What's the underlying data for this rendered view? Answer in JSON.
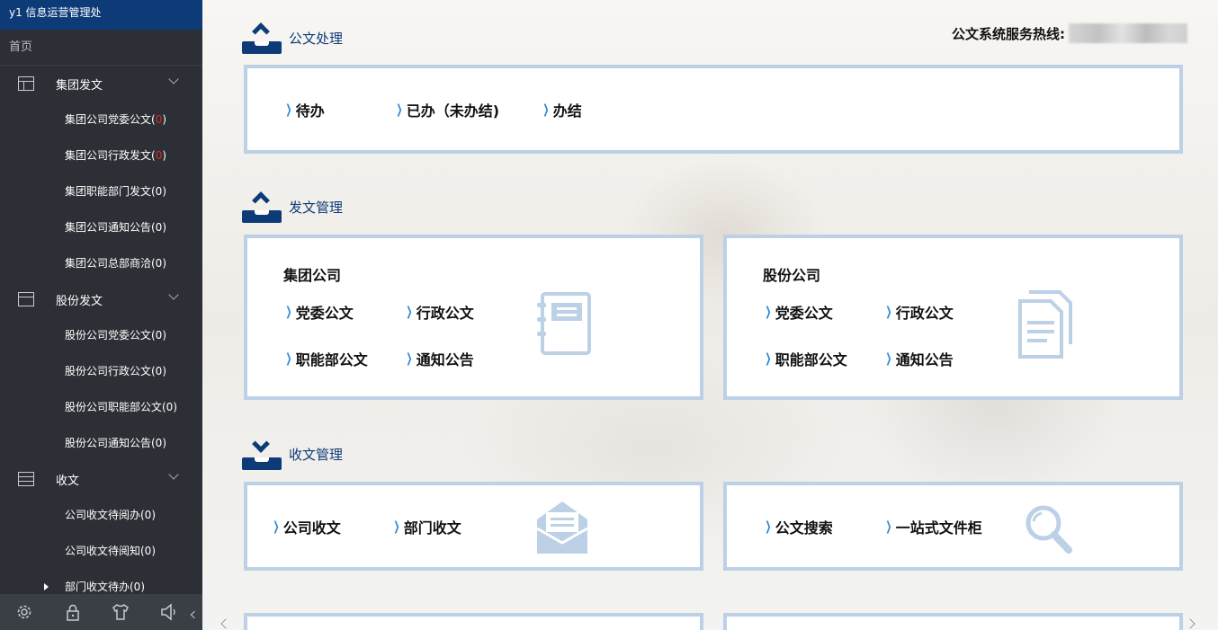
{
  "sidebar": {
    "org": "y1 信息运营管理处",
    "home": "首页",
    "groups": [
      {
        "label": "集团发文",
        "items": [
          {
            "text": "集团公司党委公文(",
            "count": "0",
            "tail": ")",
            "highlight": true
          },
          {
            "text": "集团公司行政发文(",
            "count": "0",
            "tail": ")",
            "highlight": true
          },
          {
            "text": "集团职能部门发文(0)"
          },
          {
            "text": "集团公司通知公告(0)"
          },
          {
            "text": "集团公司总部商洽(0)"
          }
        ]
      },
      {
        "label": "股份发文",
        "items": [
          {
            "text": "股份公司党委公文(0)"
          },
          {
            "text": "股份公司行政公文(0)"
          },
          {
            "text": "股份公司职能部公文(0)"
          },
          {
            "text": "股份公司通知公告(0)"
          }
        ]
      },
      {
        "label": "收文",
        "items": [
          {
            "text": "公司收文待阅办(0)"
          },
          {
            "text": "公司收文待阅知(0)"
          },
          {
            "text": "部门收文待办(0)"
          }
        ]
      }
    ],
    "bottom_icons": [
      "gear-icon",
      "lock-icon",
      "shirt-icon",
      "speaker-icon"
    ]
  },
  "header": {
    "hotline_label": "公文系统服务热线:"
  },
  "sections": {
    "processing": {
      "title": "公文处理",
      "links": [
        "待办",
        "已办（未办结)",
        "办结"
      ]
    },
    "dispatch": {
      "title": "发文管理",
      "group": {
        "title": "集团公司",
        "links": [
          "党委公文",
          "行政公文",
          "职能部公文",
          "通知公告"
        ]
      },
      "shares": {
        "title": "股份公司",
        "links": [
          "党委公文",
          "行政公文",
          "职能部公文",
          "通知公告"
        ]
      }
    },
    "receive": {
      "title": "收文管理",
      "left_links": [
        "公司收文",
        "部门收文"
      ],
      "right_links": [
        "公文搜索",
        "一站式文件柜"
      ]
    }
  },
  "colors": {
    "brand_navy": "#0d3b78",
    "panel_border": "#bcd0e6",
    "link_marker": "#2d8ad6",
    "sidebar_bg": "#2c2f35",
    "badge_red": "#e02a2a"
  }
}
